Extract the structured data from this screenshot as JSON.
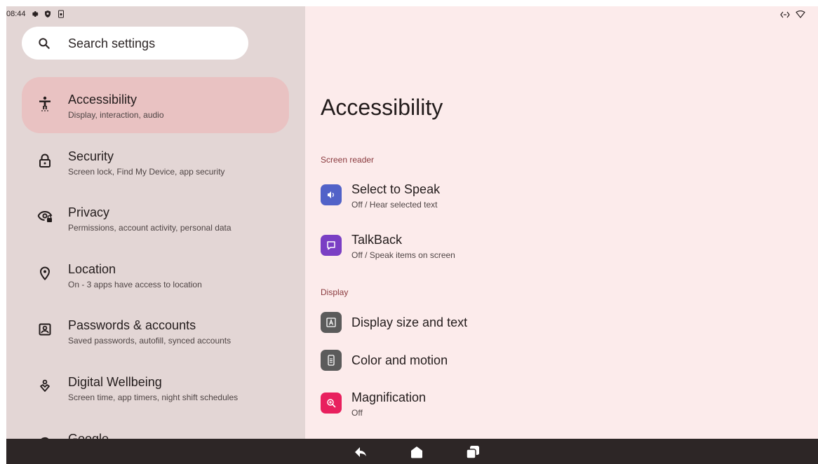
{
  "status_bar": {
    "time": "08:44",
    "icons": [
      "gear-icon",
      "shield-icon",
      "sim-icon"
    ],
    "right_icons": [
      "code-arrows-icon",
      "wifi-outline-icon"
    ]
  },
  "search": {
    "placeholder": "Search settings",
    "icon": "search-icon"
  },
  "sidebar": {
    "items": [
      {
        "title": "Accessibility",
        "subtitle": "Display, interaction, audio",
        "icon": "accessibility-icon",
        "active": true
      },
      {
        "title": "Security",
        "subtitle": "Screen lock, Find My Device, app security",
        "icon": "lock-icon"
      },
      {
        "title": "Privacy",
        "subtitle": "Permissions, account activity, personal data",
        "icon": "eye-lock-icon"
      },
      {
        "title": "Location",
        "subtitle": "On - 3 apps have access to location",
        "icon": "location-pin-icon"
      },
      {
        "title": "Passwords & accounts",
        "subtitle": "Saved passwords, autofill, synced accounts",
        "icon": "account-box-icon"
      },
      {
        "title": "Digital Wellbeing",
        "subtitle": "Screen time, app timers, night shift schedules",
        "icon": "wellbeing-icon"
      },
      {
        "title": "Google",
        "subtitle": "",
        "icon": "google-icon"
      }
    ]
  },
  "main": {
    "title": "Accessibility",
    "sections": [
      {
        "header": "Screen reader",
        "rows": [
          {
            "title": "Select to Speak",
            "subtitle": "Off / Hear selected text",
            "icon": "select-to-speak-icon",
            "color": "#5162c8"
          },
          {
            "title": "TalkBack",
            "subtitle": "Off / Speak items on screen",
            "icon": "talkback-icon",
            "color": "#7a3fc4"
          }
        ]
      },
      {
        "header": "Display",
        "rows": [
          {
            "title": "Display size and text",
            "subtitle": "",
            "icon": "text-size-icon",
            "color": "#5b5b5b"
          },
          {
            "title": "Color and motion",
            "subtitle": "",
            "icon": "color-motion-icon",
            "color": "#5b5b5b"
          },
          {
            "title": "Magnification",
            "subtitle": "Off",
            "icon": "magnification-icon",
            "color": "#e8205e"
          }
        ]
      }
    ]
  },
  "navbar": {
    "icons": [
      "back-icon",
      "home-icon",
      "recents-icon"
    ]
  },
  "colors": {
    "sidebar_bg": "#e3d6d5",
    "active_item": "#e9c2c2",
    "content_bg": "#fcebeb",
    "section_header": "#8a3a3e",
    "navbar_bg": "#2d2626"
  }
}
